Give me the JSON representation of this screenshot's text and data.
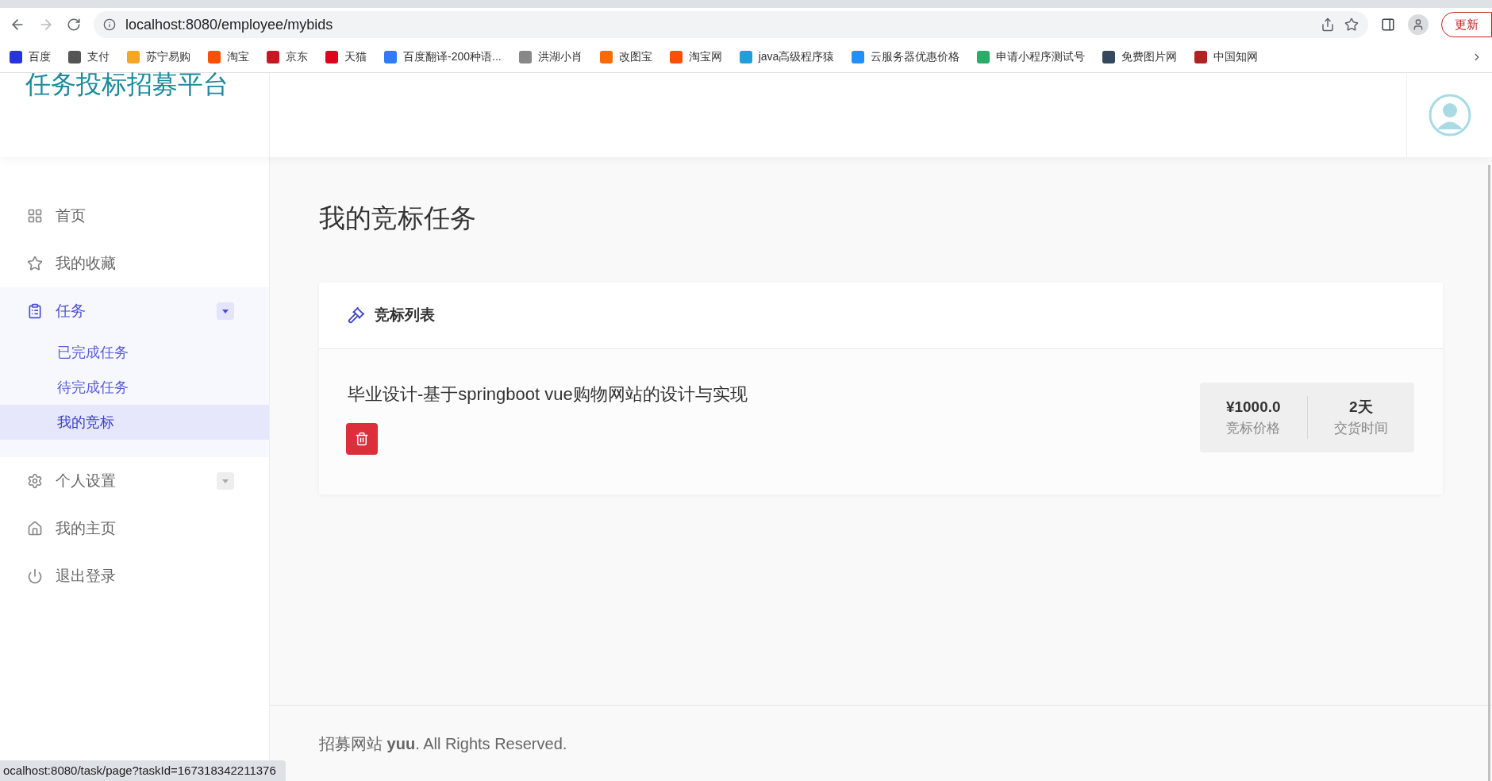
{
  "browser": {
    "url": "localhost:8080/employee/mybids",
    "update_button": "更新",
    "bookmarks": [
      {
        "label": "百度",
        "color": "#2932e1"
      },
      {
        "label": "支付",
        "color": "#555555"
      },
      {
        "label": "苏宁易购",
        "color": "#f5a623"
      },
      {
        "label": "淘宝",
        "color": "#ff5000"
      },
      {
        "label": "京东",
        "color": "#c81623"
      },
      {
        "label": "天猫",
        "color": "#e0001b"
      },
      {
        "label": "百度翻译-200种语...",
        "color": "#2f7cf6"
      },
      {
        "label": "洪湖小肖",
        "color": "#888888"
      },
      {
        "label": "改图宝",
        "color": "#ff6a00"
      },
      {
        "label": "淘宝网",
        "color": "#ff5000"
      },
      {
        "label": "java高级程序猿",
        "color": "#20a0da"
      },
      {
        "label": "云服务器优惠价格",
        "color": "#1e90ff"
      },
      {
        "label": "申请小程序测试号",
        "color": "#2aae67"
      },
      {
        "label": "免费图片网",
        "color": "#34495e"
      },
      {
        "label": "中国知网",
        "color": "#b22222"
      }
    ]
  },
  "header": {
    "logo": "任务投标招募平台"
  },
  "sidebar": {
    "items": [
      {
        "label": "首页",
        "selected": false
      },
      {
        "label": "我的收藏",
        "selected": false
      },
      {
        "label": "任务",
        "selected": true,
        "expanded": true,
        "children": [
          {
            "label": "已完成任务",
            "selected": false
          },
          {
            "label": "待完成任务",
            "selected": false
          },
          {
            "label": "我的竞标",
            "selected": true
          }
        ]
      },
      {
        "label": "个人设置",
        "selected": false,
        "expanded": false
      },
      {
        "label": "我的主页",
        "selected": false
      },
      {
        "label": "退出登录",
        "selected": false
      }
    ]
  },
  "main": {
    "title": "我的竞标任务",
    "card": {
      "title": "竞标列表",
      "bids": [
        {
          "title": "毕业设计-基于springboot vue购物网站的设计与实现",
          "price": "¥1000.0",
          "price_label": "竞标价格",
          "days": "2天",
          "days_label": "交货时间"
        }
      ]
    }
  },
  "footer": {
    "text": "招募网站 **yuu**. All Rights Reserved."
  },
  "status_url": "ocalhost:8080/task/page?taskId=167318342211376"
}
